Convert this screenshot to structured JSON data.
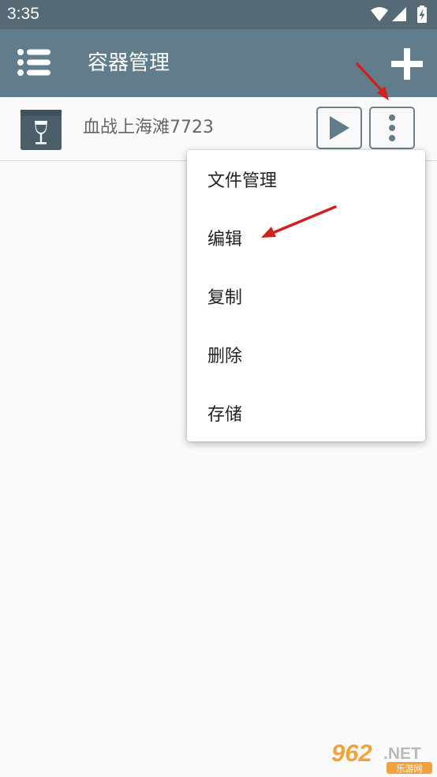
{
  "status_bar": {
    "time": "3:35",
    "icons": [
      "wifi-icon",
      "signal-icon",
      "battery-charging-icon"
    ]
  },
  "app_bar": {
    "title": "容器管理",
    "menu_icon": "list-menu-icon",
    "add_icon": "plus-icon"
  },
  "containers": [
    {
      "name": "血战上海滩7723",
      "icon": "wine-glass-box-icon",
      "actions": [
        "play-icon",
        "more-vert-icon"
      ]
    }
  ],
  "popup_menu": {
    "items": [
      {
        "label": "文件管理"
      },
      {
        "label": "编辑"
      },
      {
        "label": "复制"
      },
      {
        "label": "删除"
      },
      {
        "label": "存储"
      }
    ]
  },
  "colors": {
    "status_bar": "#566a75",
    "app_bar": "#617d8b",
    "accent_icon": "#4a5e6a",
    "annotation_arrow": "#d21f1f"
  },
  "watermark": {
    "brand": "962",
    "suffix": ".NET",
    "subtitle": "乐游网"
  }
}
